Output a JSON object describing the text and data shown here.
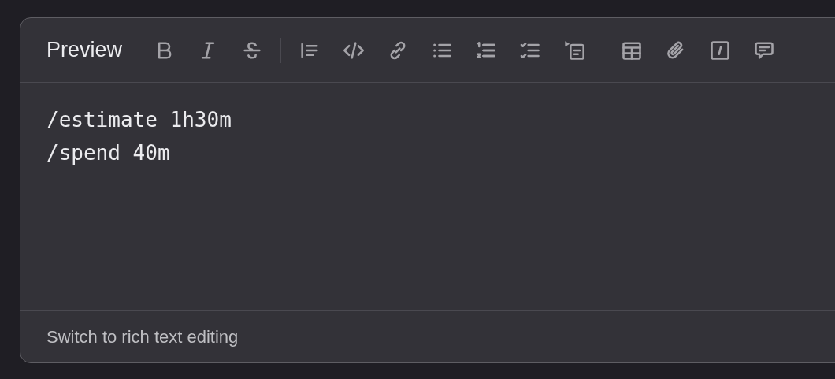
{
  "toolbar": {
    "preview_button": "Preview"
  },
  "editor": {
    "lines": [
      "/estimate 1h30m",
      "/spend 40m"
    ]
  },
  "footer": {
    "link": "Switch to rich text editing"
  }
}
